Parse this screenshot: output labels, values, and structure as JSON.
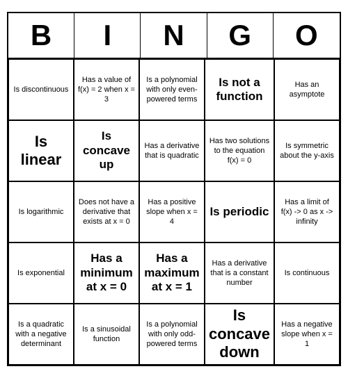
{
  "header": {
    "letters": [
      "B",
      "I",
      "N",
      "G",
      "O"
    ]
  },
  "cells": [
    {
      "text": "Is discontinuous",
      "size": "normal"
    },
    {
      "text": "Has a value of f(x) = 2 when x = 3",
      "size": "normal"
    },
    {
      "text": "Is a polynomial with only even-powered terms",
      "size": "normal"
    },
    {
      "text": "Is not a function",
      "size": "medium"
    },
    {
      "text": "Has an asymptote",
      "size": "normal"
    },
    {
      "text": "Is linear",
      "size": "large"
    },
    {
      "text": "Is concave up",
      "size": "medium"
    },
    {
      "text": "Has a derivative that is quadratic",
      "size": "normal"
    },
    {
      "text": "Has two solutions to the equation f(x) = 0",
      "size": "normal"
    },
    {
      "text": "Is symmetric about the y-axis",
      "size": "normal"
    },
    {
      "text": "Is logarithmic",
      "size": "normal"
    },
    {
      "text": "Does not have a derivative that exists at x = 0",
      "size": "normal"
    },
    {
      "text": "Has a positive slope when x = 4",
      "size": "normal"
    },
    {
      "text": "Is periodic",
      "size": "medium"
    },
    {
      "text": "Has a limit of f(x) -> 0 as x -> infinity",
      "size": "normal"
    },
    {
      "text": "Is exponential",
      "size": "normal"
    },
    {
      "text": "Has a minimum at x = 0",
      "size": "medium"
    },
    {
      "text": "Has a maximum at x = 1",
      "size": "medium"
    },
    {
      "text": "Has a derivative that is a constant number",
      "size": "normal"
    },
    {
      "text": "Is continuous",
      "size": "normal"
    },
    {
      "text": "Is a quadratic with a negative determinant",
      "size": "normal"
    },
    {
      "text": "Is a sinusoidal function",
      "size": "normal"
    },
    {
      "text": "Is a polynomial with only odd-powered terms",
      "size": "normal"
    },
    {
      "text": "Is concave down",
      "size": "large"
    },
    {
      "text": "Has a negative slope when x = 1",
      "size": "normal"
    }
  ]
}
